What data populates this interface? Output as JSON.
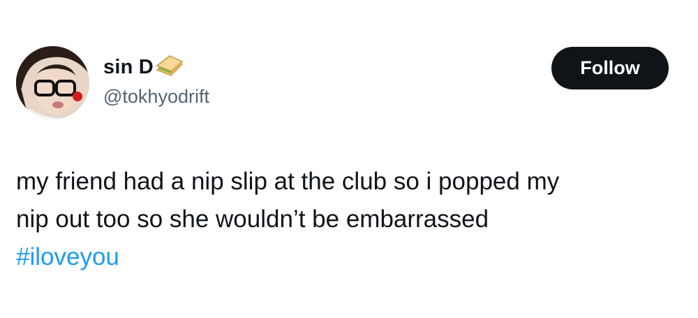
{
  "author": {
    "display_name": "sin D",
    "name_emoji": "sandwich-icon",
    "handle": "@tokhyodrift",
    "avatar": "avatar"
  },
  "actions": {
    "follow_label": "Follow"
  },
  "tweet": {
    "lines": [
      "my friend had a nip slip at the club so i popped my",
      "nip out too so she wouldn’t be embarrassed"
    ],
    "hashtag": "#iloveyou"
  },
  "colors": {
    "text": "#0f1419",
    "secondary": "#536471",
    "link": "#1d9bf0",
    "button_bg": "#0f1419",
    "button_text": "#ffffff"
  }
}
